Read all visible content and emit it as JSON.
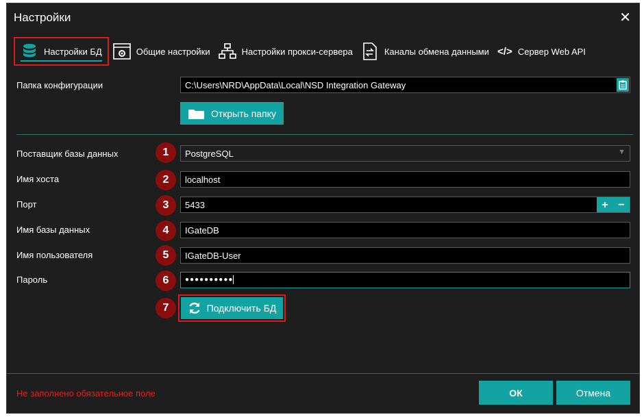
{
  "window": {
    "title": "Настройки",
    "close_glyph": "✕"
  },
  "tabs": [
    {
      "label": "Настройки БД",
      "icon": "database-icon",
      "active": true
    },
    {
      "label": "Общие настройки",
      "icon": "settings-window-icon"
    },
    {
      "label": "Настройки прокси-сервера",
      "icon": "network-icon"
    },
    {
      "label": "Каналы обмена данными",
      "icon": "exchange-icon"
    },
    {
      "label": "Сервер Web API",
      "icon": "code-icon",
      "icon_text": "</>"
    }
  ],
  "config": {
    "label": "Папка конфигурации",
    "path": "C:\\Users\\NRD\\AppData\\Local\\NSD Integration Gateway",
    "open_folder_label": "Открыть папку"
  },
  "db": {
    "provider_label": "Поставщик базы данных",
    "provider_value": "PostgreSQL",
    "host_label": "Имя хоста",
    "host_value": "localhost",
    "port_label": "Порт",
    "port_value": "5433",
    "dbname_label": "Имя базы данных",
    "dbname_value": "IGateDB",
    "user_label": "Имя пользователя",
    "user_value": "IGateDB-User",
    "password_label": "Пароль",
    "password_value": "●●●●●●●●●●",
    "connect_label": "Подключить БД"
  },
  "badges": [
    "1",
    "2",
    "3",
    "4",
    "5",
    "6",
    "7"
  ],
  "spin": {
    "plus": "+",
    "minus": "−"
  },
  "footer": {
    "error": "Не заполнено обязательное поле",
    "ok_label": "ОК",
    "cancel_label": "Отмена"
  },
  "colors": {
    "accent": "#13a3a3",
    "highlight": "#d81b1b",
    "badge": "#8b0e0e",
    "error": "#e02020"
  }
}
